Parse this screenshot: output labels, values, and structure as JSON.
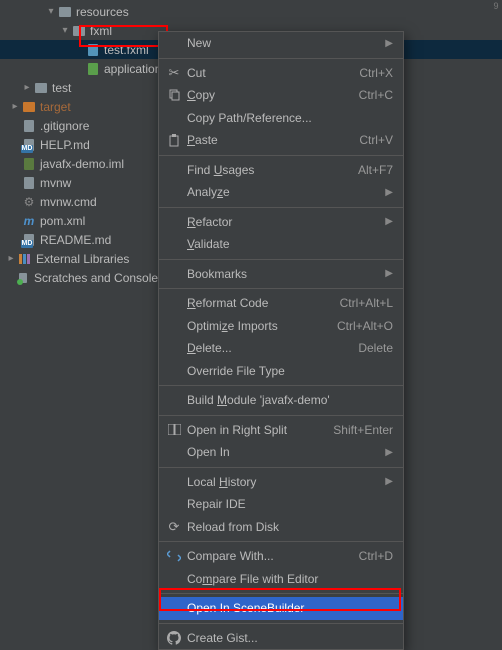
{
  "gutter": "9",
  "tree": {
    "resources": "resources",
    "fxml": "fxml",
    "testfxml": "test.fxml",
    "application": "application",
    "test": "test",
    "target": "target",
    "gitignore": ".gitignore",
    "help": "HELP.md",
    "iml": "javafx-demo.iml",
    "mvnw": "mvnw",
    "mvnwcmd": "mvnw.cmd",
    "pom": "pom.xml",
    "readme": "README.md",
    "extlib": "External Libraries",
    "scratches": "Scratches and Consoles"
  },
  "badges": {
    "md": "MD",
    "m": "m"
  },
  "menu": {
    "new": "New",
    "cut": "Cut",
    "cut_sc": "Ctrl+X",
    "copy": "Copy",
    "copy_sc": "Ctrl+C",
    "copypath": "Copy Path/Reference...",
    "paste": "Paste",
    "paste_sc": "Ctrl+V",
    "findusages": "Find Usages",
    "findusages_sc": "Alt+F7",
    "analyze": "Analyze",
    "refactor": "Refactor",
    "validate": "Validate",
    "bookmarks": "Bookmarks",
    "reformat": "Reformat Code",
    "reformat_sc": "Ctrl+Alt+L",
    "optimize": "Optimize Imports",
    "optimize_sc": "Ctrl+Alt+O",
    "delete": "Delete...",
    "delete_sc": "Delete",
    "override": "Override File Type",
    "buildmodule": "Build Module 'javafx-demo'",
    "openrightsplit": "Open in Right Split",
    "openrightsplit_sc": "Shift+Enter",
    "openin": "Open In",
    "localhistory": "Local History",
    "repairide": "Repair IDE",
    "reload": "Reload from Disk",
    "comparewith": "Compare With...",
    "comparewith_sc": "Ctrl+D",
    "comparefile": "Compare File with Editor",
    "openinsb": "Open In SceneBuilder",
    "creategist": "Create Gist..."
  }
}
